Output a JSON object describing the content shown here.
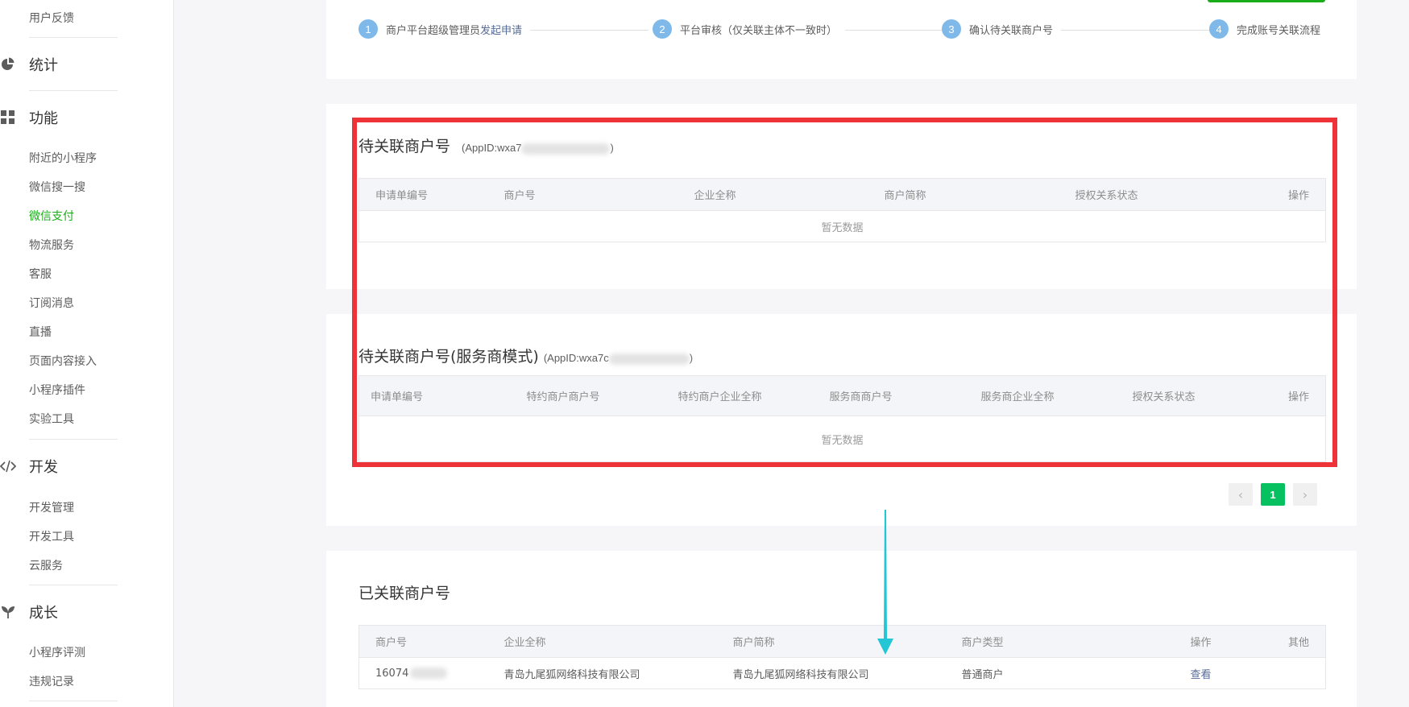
{
  "sidebar": {
    "top_item": "用户反馈",
    "categories": {
      "stats": "统计",
      "features": "功能",
      "dev": "开发",
      "growth": "成长"
    },
    "features_items": [
      "附近的小程序",
      "微信搜一搜",
      "微信支付",
      "物流服务",
      "客服",
      "订阅消息",
      "直播",
      "页面内容接入",
      "小程序插件",
      "实验工具"
    ],
    "dev_items": [
      "开发管理",
      "开发工具",
      "云服务"
    ],
    "growth_items": [
      "小程序评测",
      "违规记录"
    ],
    "active_item": "微信支付",
    "icons": [
      "pie-chart-icon",
      "grid-icon",
      "code-icon",
      "sprout-icon"
    ]
  },
  "steps": [
    {
      "num": "1",
      "text": "商户平台超级管理员",
      "link": "发起申请"
    },
    {
      "num": "2",
      "text": "平台审核（仅关联主体不一致时）"
    },
    {
      "num": "3",
      "text": "确认待关联商户号"
    },
    {
      "num": "4",
      "text": "完成账号关联流程"
    }
  ],
  "pending": {
    "title": "待关联商户号",
    "appid_prefix": "(AppID:wxa7",
    "appid_suffix": ")",
    "columns": [
      "申请单编号",
      "商户号",
      "企业全称",
      "商户简称",
      "授权关系状态",
      "操作"
    ],
    "empty_text": "暂无数据"
  },
  "pending_sp": {
    "title": "待关联商户号(服务商模式)",
    "appid_prefix": "(AppID:wxa7c",
    "appid_suffix": ")",
    "columns": [
      "申请单编号",
      "特约商户商户号",
      "特约商户企业全称",
      "服务商商户号",
      "服务商企业全称",
      "授权关系状态",
      "操作"
    ],
    "empty_text": "暂无数据"
  },
  "pagination": {
    "prev": "‹",
    "current": "1",
    "next": "›"
  },
  "linked": {
    "title": "已关联商户号",
    "columns": [
      "商户号",
      "企业全称",
      "商户简称",
      "商户类型",
      "操作",
      "其他"
    ],
    "rows": [
      {
        "merchant_id": "16074",
        "company": "青岛九尾狐网络科技有限公司",
        "short_name": "青岛九尾狐网络科技有限公司",
        "type": "普通商户",
        "action": "查看",
        "other": ""
      }
    ]
  },
  "colors": {
    "accent": "#1aad19",
    "highlight_box": "#ee3338",
    "arrow": "#22c6d4",
    "step_circle": "#7fb9e9",
    "link": "#576b95"
  }
}
